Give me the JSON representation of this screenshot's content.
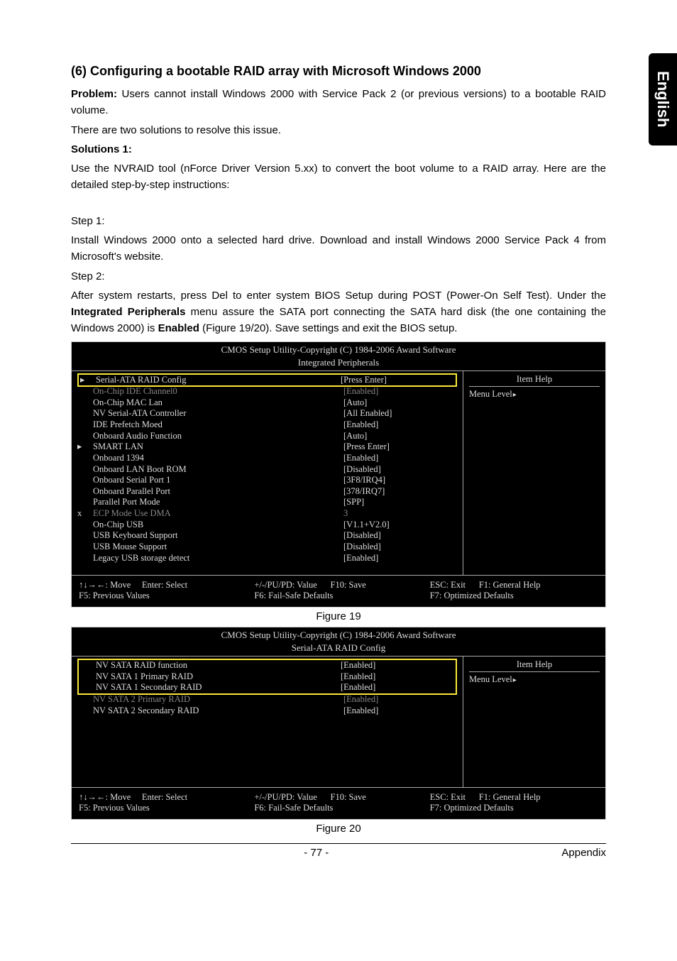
{
  "sideTab": "English",
  "heading": "(6) Configuring a bootable RAID array with Microsoft Windows 2000",
  "problemLabel": "Problem:",
  "problemText": " Users cannot install Windows 2000 with Service Pack 2 (or previous versions) to a bootable RAID volume.",
  "line2": "There are two solutions to resolve this issue.",
  "sol1Label": "Solutions 1:",
  "sol1Text": "Use the NVRAID tool (nForce Driver Version 5.xx) to convert the boot volume to a RAID array. Here are the detailed step-by-step instructions:",
  "step1Label": "Step 1:",
  "step1Text": "Install Windows 2000 onto a selected hard drive. Download and install Windows 2000 Service Pack 4 from Microsoft's website.",
  "step2Label": "Step 2:",
  "step2Pre": "After system restarts, press Del to enter system BIOS Setup during POST (Power-On Self Test). Under the ",
  "step2Bold1": "Integrated Peripherals",
  "step2Mid": " menu assure the SATA port connecting the SATA hard disk (the one containing the Windows 2000) is ",
  "step2Bold2": "Enabled",
  "step2Post": " (Figure 19/20). Save settings and exit the BIOS setup.",
  "bios1": {
    "header": "CMOS Setup Utility-Copyright (C) 1984-2006 Award Software",
    "sub": "Integrated Peripherals",
    "rows": [
      {
        "m": "▸",
        "l": "Serial-ATA RAID Config",
        "v": "[Press Enter]",
        "hl": true
      },
      {
        "m": "",
        "l": "On-Chip IDE Channel0",
        "v": "[Enabled]",
        "g": true
      },
      {
        "m": "",
        "l": "On-Chip MAC Lan",
        "v": "[Auto]"
      },
      {
        "m": "",
        "l": "NV Serial-ATA Controller",
        "v": "[All Enabled]"
      },
      {
        "m": "",
        "l": "IDE Prefetch Moed",
        "v": "[Enabled]"
      },
      {
        "m": "",
        "l": "Onboard Audio Function",
        "v": "[Auto]"
      },
      {
        "m": "▸",
        "l": "SMART LAN",
        "v": "[Press Enter]"
      },
      {
        "m": "",
        "l": "Onboard 1394",
        "v": "[Enabled]"
      },
      {
        "m": "",
        "l": "Onboard LAN Boot ROM",
        "v": "[Disabled]"
      },
      {
        "m": "",
        "l": "Onboard Serial Port 1",
        "v": "[3F8/IRQ4]"
      },
      {
        "m": "",
        "l": "Onboard Parallel Port",
        "v": "[378/IRQ7]"
      },
      {
        "m": "",
        "l": "Parallel Port Mode",
        "v": "[SPP]"
      },
      {
        "m": "x",
        "l": "ECP Mode Use DMA",
        "v": "3",
        "g": true
      },
      {
        "m": "",
        "l": "On-Chip USB",
        "v": "[V1.1+V2.0]"
      },
      {
        "m": "",
        "l": "USB Keyboard Support",
        "v": "[Disabled]"
      },
      {
        "m": "",
        "l": "USB Mouse Support",
        "v": "[Disabled]"
      },
      {
        "m": "",
        "l": "Legacy USB storage detect",
        "v": "[Enabled]"
      }
    ],
    "rightTitle": "Item Help",
    "rightMenu": "Menu Level",
    "footer": {
      "c1a": "↑↓→←: Move     Enter: Select",
      "c1b": "F5: Previous Values",
      "c2a": "+/-/PU/PD: Value      F10: Save",
      "c2b": "F6: Fail-Safe Defaults",
      "c3a": "ESC: Exit      F1: General Help",
      "c3b": "F7: Optimized Defaults"
    }
  },
  "fig19": "Figure 19",
  "bios2": {
    "header": "CMOS Setup Utility-Copyright (C) 1984-2006 Award Software",
    "sub": "Serial-ATA RAID Config",
    "rows": [
      {
        "m": "",
        "l": "NV SATA RAID function",
        "v": "[Enabled]",
        "hl": true
      },
      {
        "m": "",
        "l": "NV SATA 1 Primary RAID",
        "v": "[Enabled]",
        "hl": true
      },
      {
        "m": "",
        "l": "NV SATA 1 Secondary RAID",
        "v": "[Enabled]",
        "hl": true
      },
      {
        "m": "",
        "l": "NV SATA 2 Primary RAID",
        "v": "[Enabled]",
        "g": true
      },
      {
        "m": "",
        "l": "NV SATA 2 Secondary RAID",
        "v": "[Enabled]"
      }
    ],
    "rightTitle": "Item Help",
    "rightMenu": "Menu Level",
    "footer": {
      "c1a": "↑↓→←: Move     Enter: Select",
      "c1b": "F5: Previous Values",
      "c2a": "+/-/PU/PD: Value      F10: Save",
      "c2b": "F6: Fail-Safe Defaults",
      "c3a": "ESC: Exit      F1: General Help",
      "c3b": "F7: Optimized Defaults"
    }
  },
  "fig20": "Figure 20",
  "pageNum": "- 77 -",
  "appendix": "Appendix"
}
